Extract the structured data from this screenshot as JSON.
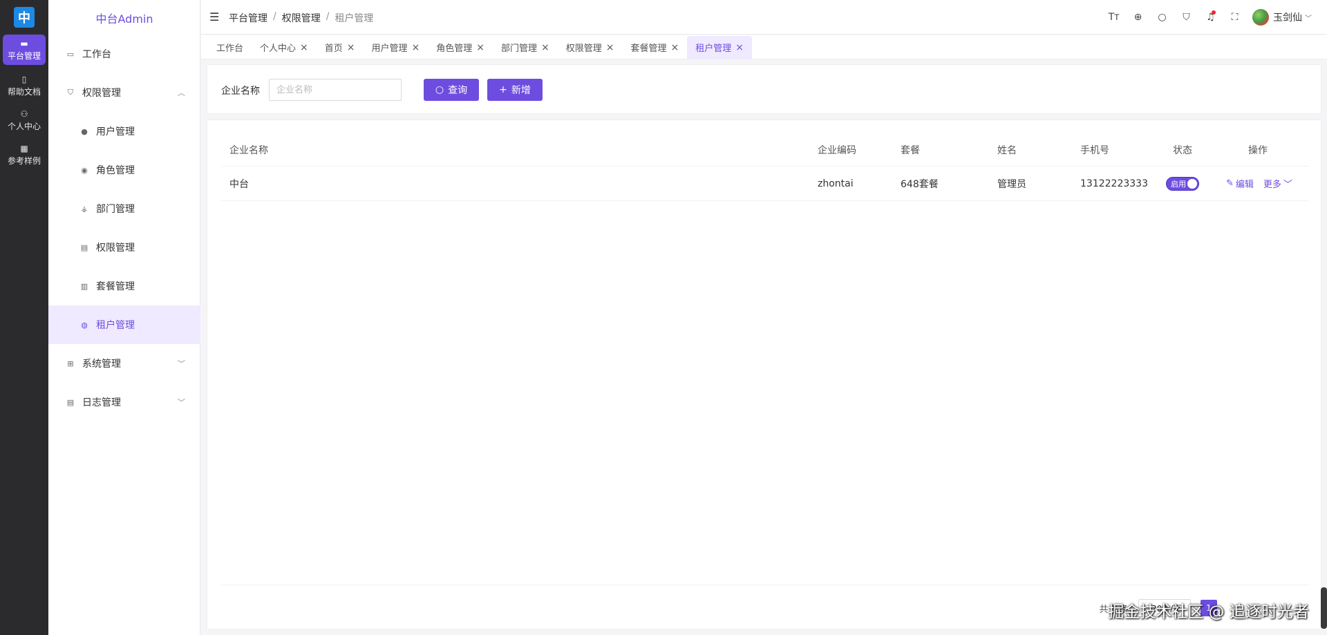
{
  "rail": {
    "logo": "中",
    "items": [
      {
        "label": "平台管理",
        "icon": "monitor-icon",
        "active": true
      },
      {
        "label": "帮助文档",
        "icon": "book-icon",
        "active": false
      },
      {
        "label": "个人中心",
        "icon": "user-icon",
        "active": false
      },
      {
        "label": "参考样例",
        "icon": "grid-icon",
        "active": false
      }
    ]
  },
  "side": {
    "brand": "中台Admin",
    "menu": [
      {
        "label": "工作台",
        "icon": "dashboard-icon"
      },
      {
        "label": "权限管理",
        "icon": "shield-icon"
      },
      {
        "label": "用户管理",
        "icon": "user-icon"
      },
      {
        "label": "角色管理",
        "icon": "role-icon"
      },
      {
        "label": "部门管理",
        "icon": "org-icon"
      },
      {
        "label": "权限管理",
        "icon": "permission-icon"
      },
      {
        "label": "套餐管理",
        "icon": "package-icon"
      },
      {
        "label": "租户管理",
        "icon": "tenant-icon"
      },
      {
        "label": "系统管理",
        "icon": "windows-icon"
      },
      {
        "label": "日志管理",
        "icon": "log-icon"
      }
    ]
  },
  "header": {
    "breadcrumb": [
      "平台管理",
      "权限管理",
      "租户管理"
    ],
    "icons": [
      "font-size-icon",
      "globe-icon",
      "search-icon",
      "shirt-icon",
      "bell-icon",
      "fullscreen-icon"
    ],
    "user_name": "玉剑仙"
  },
  "tabs": [
    "工作台",
    "个人中心",
    "首页",
    "用户管理",
    "角色管理",
    "部门管理",
    "权限管理",
    "套餐管理",
    "租户管理"
  ],
  "search": {
    "label": "企业名称",
    "placeholder": "企业名称",
    "query_label": "查询",
    "add_label": "新增"
  },
  "table": {
    "columns": [
      "企业名称",
      "企业编码",
      "套餐",
      "姓名",
      "手机号",
      "状态",
      "操作"
    ],
    "rows": [
      {
        "name": "中台",
        "code": "zhontai",
        "package": "648套餐",
        "contact": "管理员",
        "phone": "13122223333",
        "status": "启用",
        "edit": "编辑",
        "more": "更多"
      }
    ]
  },
  "pagination": {
    "total": "共 1 条",
    "page_size": "20条/页",
    "current": "1"
  },
  "watermark": "掘金技术社区 @ 追逐时光者",
  "colors": {
    "accent": "#6d4de0",
    "rail_bg": "#2b2b2e",
    "active_bg": "#efeaff"
  }
}
